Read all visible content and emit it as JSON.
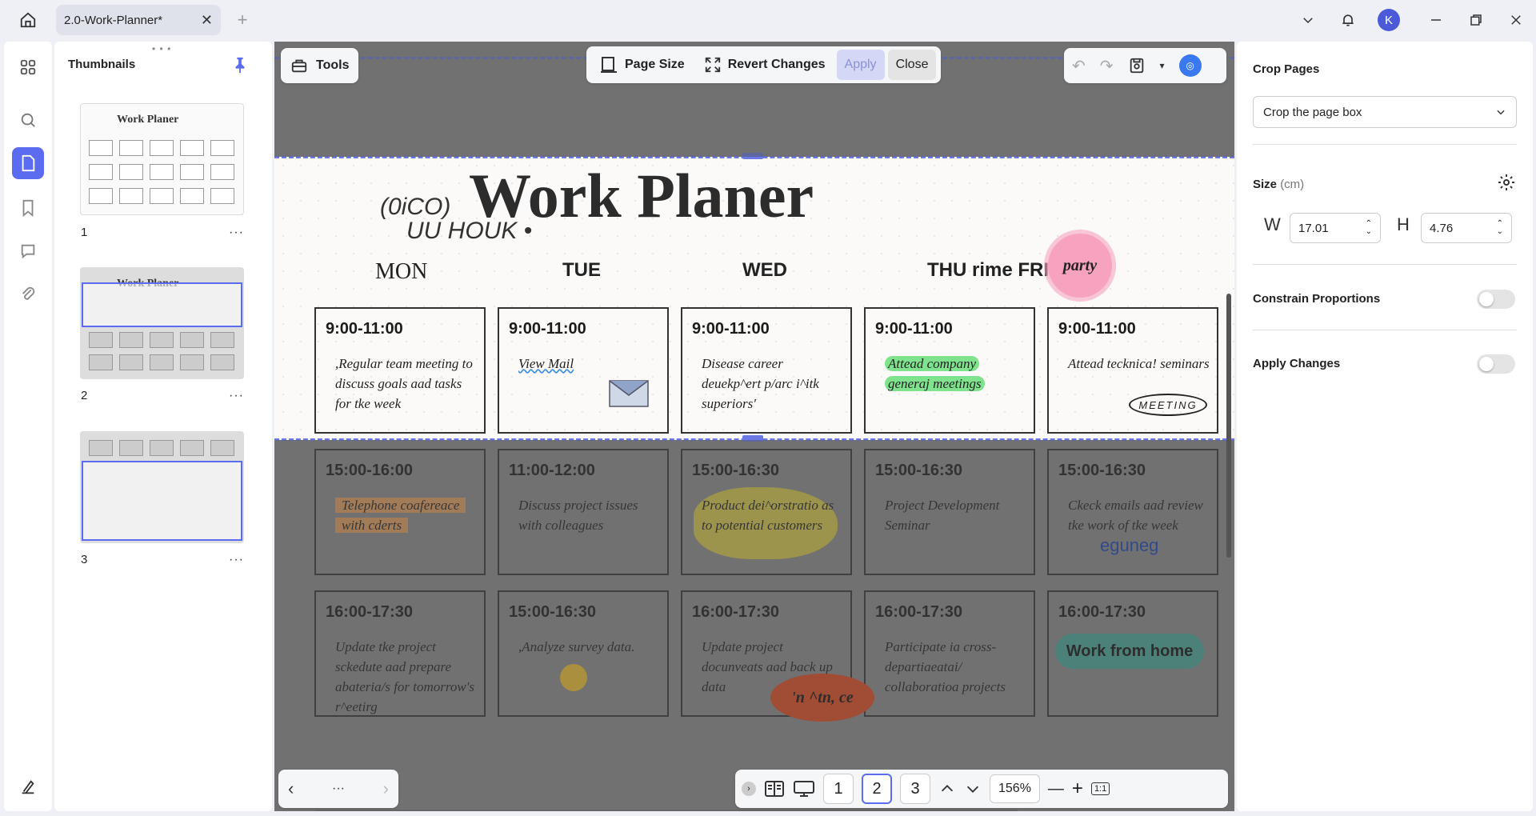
{
  "titlebar": {
    "tab_label": "2.0-Work-Planner*",
    "tab_close": "✕",
    "new_tab": "+",
    "avatar_letter": "K"
  },
  "thumbnails": {
    "title": "Thumbnails",
    "items": [
      {
        "number": "1",
        "more": "···"
      },
      {
        "number": "2",
        "more": "···"
      },
      {
        "number": "3",
        "more": "···"
      }
    ],
    "thumb_title": "Work Planer"
  },
  "toolbar": {
    "tools_label": "Tools",
    "page_size_label": "Page Size",
    "revert_label": "Revert Changes",
    "apply_label": "Apply",
    "close_label": "Close"
  },
  "document": {
    "title": "Work Planer",
    "logo_line1": "(0iCO)",
    "logo_line2": "UU HOUK •",
    "days": [
      "MON",
      "TUE",
      "WED",
      "THU rime FRI"
    ],
    "party": "party",
    "row1": [
      {
        "time": "9:00-11:00",
        "note": ",Regular team meeting to discuss goals aad tasks for tke week"
      },
      {
        "time": "9:00-11:00",
        "note": "View Mail"
      },
      {
        "time": "9:00-11:00",
        "note": "Disease career deuekp^ert p/arc i^itk superiors'"
      },
      {
        "time": "9:00-11:00",
        "note1": "Attead company",
        "note2": "generaj meetings"
      },
      {
        "time": "9:00-11:00",
        "note": "Attead tecknica! seminars",
        "badge": "MEETING"
      }
    ],
    "row2": [
      {
        "time": "15:00-16:00",
        "note1": "Telephone coafereace",
        "note2": "with cderts"
      },
      {
        "time": "11:00-12:00",
        "note": "Discuss project issues with colleagues"
      },
      {
        "time": "15:00-16:30",
        "note": "Product dei^orstratio as to potential customers"
      },
      {
        "time": "15:00-16:30",
        "note": "Project Development Seminar"
      },
      {
        "time": "15:00-16:30",
        "note": "Ckeck emails aad review tke work of tke week",
        "extra": "eguneg"
      }
    ],
    "row3": [
      {
        "time": "16:00-17:30",
        "note": "Update tke project sckedute aad prepare abateria/s for tomorrow's r^eetirg"
      },
      {
        "time": "15:00-16:30",
        "note": ",Analyze survey data."
      },
      {
        "time": "16:00-17:30",
        "note": "Update project docunveats aad back up data"
      },
      {
        "time": "16:00-17:30",
        "note": "Participate ia cross-departiaeatai/ collaboratioa projects"
      },
      {
        "time": "16:00-17:30",
        "pill": "Work from home"
      }
    ],
    "sticker": "'n ^tn, ce"
  },
  "pagebar": {
    "pages": [
      "1",
      "2",
      "3"
    ],
    "zoom": "156%",
    "minus": "—",
    "plus": "+",
    "fit": "1:1",
    "more": "···"
  },
  "rightpanel": {
    "crop_title": "Crop Pages",
    "crop_option": "Crop the page box",
    "size_title": "Size",
    "size_unit": "(cm)",
    "w_label": "W",
    "w_value": "17.01",
    "h_label": "H",
    "h_value": "4.76",
    "constrain_label": "Constrain Proportions",
    "apply_changes_label": "Apply Changes",
    "constrain_on": false,
    "apply_on": false
  },
  "colors": {
    "accent": "#5b6cf0",
    "crop_dash": "#6b78e6",
    "highlight_green": "#7fe38e",
    "highlight_orange": "#e6a060",
    "pill_teal": "#4aaa9c",
    "party_pink": "#f7a3bf"
  }
}
